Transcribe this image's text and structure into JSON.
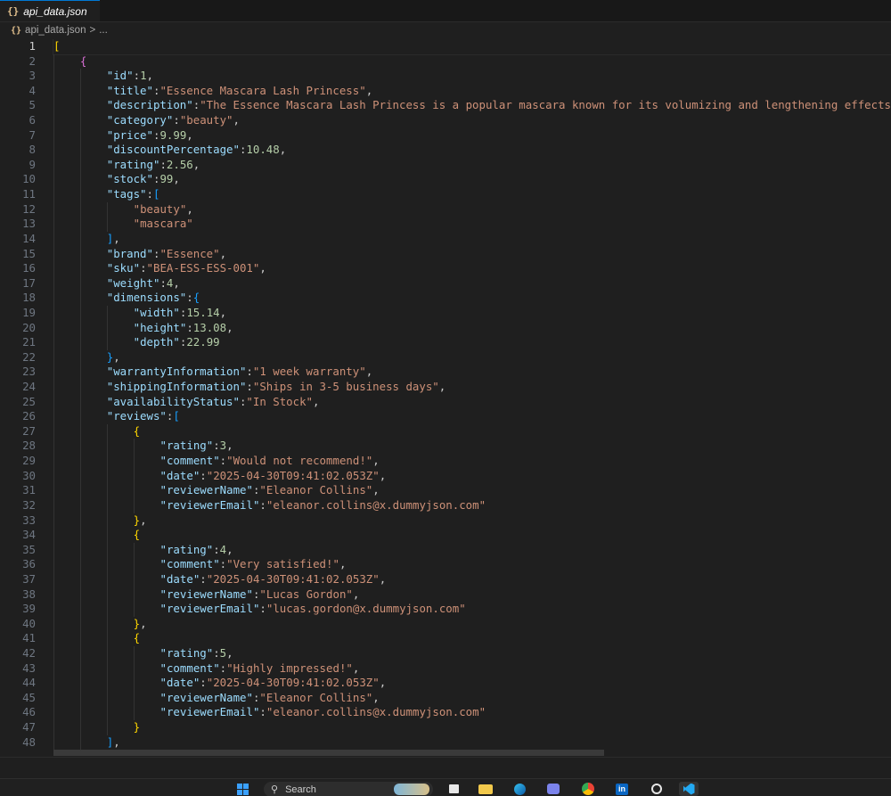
{
  "tab": {
    "file_name": "api_data.json",
    "icon": "json-braces-icon",
    "icon_glyph": "{}"
  },
  "breadcrumb": {
    "file_name": "api_data.json",
    "separator": ">",
    "more": "..."
  },
  "editor": {
    "active_line": 1,
    "lines": [
      [
        [
          "b1",
          "["
        ]
      ],
      [
        [
          "b2",
          "{"
        ]
      ],
      [
        [
          "key",
          "\"id\""
        ],
        [
          "p",
          ":"
        ],
        [
          "num",
          "1"
        ],
        [
          "p",
          ","
        ]
      ],
      [
        [
          "key",
          "\"title\""
        ],
        [
          "p",
          ":"
        ],
        [
          "str",
          "\"Essence Mascara Lash Princess\""
        ],
        [
          "p",
          ","
        ]
      ],
      [
        [
          "key",
          "\"description\""
        ],
        [
          "p",
          ":"
        ],
        [
          "str",
          "\"The Essence Mascara Lash Princess is a popular mascara known for its volumizing and lengthening effects. Achieve d"
        ]
      ],
      [
        [
          "key",
          "\"category\""
        ],
        [
          "p",
          ":"
        ],
        [
          "str",
          "\"beauty\""
        ],
        [
          "p",
          ","
        ]
      ],
      [
        [
          "key",
          "\"price\""
        ],
        [
          "p",
          ":"
        ],
        [
          "num",
          "9.99"
        ],
        [
          "p",
          ","
        ]
      ],
      [
        [
          "key",
          "\"discountPercentage\""
        ],
        [
          "p",
          ":"
        ],
        [
          "num",
          "10.48"
        ],
        [
          "p",
          ","
        ]
      ],
      [
        [
          "key",
          "\"rating\""
        ],
        [
          "p",
          ":"
        ],
        [
          "num",
          "2.56"
        ],
        [
          "p",
          ","
        ]
      ],
      [
        [
          "key",
          "\"stock\""
        ],
        [
          "p",
          ":"
        ],
        [
          "num",
          "99"
        ],
        [
          "p",
          ","
        ]
      ],
      [
        [
          "key",
          "\"tags\""
        ],
        [
          "p",
          ":"
        ],
        [
          "b3",
          "["
        ]
      ],
      [
        [
          "str",
          "\"beauty\""
        ],
        [
          "p",
          ","
        ]
      ],
      [
        [
          "str",
          "\"mascara\""
        ]
      ],
      [
        [
          "b3",
          "]"
        ],
        [
          "p",
          ","
        ]
      ],
      [
        [
          "key",
          "\"brand\""
        ],
        [
          "p",
          ":"
        ],
        [
          "str",
          "\"Essence\""
        ],
        [
          "p",
          ","
        ]
      ],
      [
        [
          "key",
          "\"sku\""
        ],
        [
          "p",
          ":"
        ],
        [
          "str",
          "\"BEA-ESS-ESS-001\""
        ],
        [
          "p",
          ","
        ]
      ],
      [
        [
          "key",
          "\"weight\""
        ],
        [
          "p",
          ":"
        ],
        [
          "num",
          "4"
        ],
        [
          "p",
          ","
        ]
      ],
      [
        [
          "key",
          "\"dimensions\""
        ],
        [
          "p",
          ":"
        ],
        [
          "b3",
          "{"
        ]
      ],
      [
        [
          "key",
          "\"width\""
        ],
        [
          "p",
          ":"
        ],
        [
          "num",
          "15.14"
        ],
        [
          "p",
          ","
        ]
      ],
      [
        [
          "key",
          "\"height\""
        ],
        [
          "p",
          ":"
        ],
        [
          "num",
          "13.08"
        ],
        [
          "p",
          ","
        ]
      ],
      [
        [
          "key",
          "\"depth\""
        ],
        [
          "p",
          ":"
        ],
        [
          "num",
          "22.99"
        ]
      ],
      [
        [
          "b3",
          "}"
        ],
        [
          "p",
          ","
        ]
      ],
      [
        [
          "key",
          "\"warrantyInformation\""
        ],
        [
          "p",
          ":"
        ],
        [
          "str",
          "\"1 week warranty\""
        ],
        [
          "p",
          ","
        ]
      ],
      [
        [
          "key",
          "\"shippingInformation\""
        ],
        [
          "p",
          ":"
        ],
        [
          "str",
          "\"Ships in 3-5 business days\""
        ],
        [
          "p",
          ","
        ]
      ],
      [
        [
          "key",
          "\"availabilityStatus\""
        ],
        [
          "p",
          ":"
        ],
        [
          "str",
          "\"In Stock\""
        ],
        [
          "p",
          ","
        ]
      ],
      [
        [
          "key",
          "\"reviews\""
        ],
        [
          "p",
          ":"
        ],
        [
          "b3",
          "["
        ]
      ],
      [
        [
          "b1",
          "{"
        ]
      ],
      [
        [
          "key",
          "\"rating\""
        ],
        [
          "p",
          ":"
        ],
        [
          "num",
          "3"
        ],
        [
          "p",
          ","
        ]
      ],
      [
        [
          "key",
          "\"comment\""
        ],
        [
          "p",
          ":"
        ],
        [
          "str",
          "\"Would not recommend!\""
        ],
        [
          "p",
          ","
        ]
      ],
      [
        [
          "key",
          "\"date\""
        ],
        [
          "p",
          ":"
        ],
        [
          "str",
          "\"2025-04-30T09:41:02.053Z\""
        ],
        [
          "p",
          ","
        ]
      ],
      [
        [
          "key",
          "\"reviewerName\""
        ],
        [
          "p",
          ":"
        ],
        [
          "str",
          "\"Eleanor Collins\""
        ],
        [
          "p",
          ","
        ]
      ],
      [
        [
          "key",
          "\"reviewerEmail\""
        ],
        [
          "p",
          ":"
        ],
        [
          "str",
          "\"eleanor.collins@x.dummyjson.com\""
        ]
      ],
      [
        [
          "b1",
          "}"
        ],
        [
          "p",
          ","
        ]
      ],
      [
        [
          "b1",
          "{"
        ]
      ],
      [
        [
          "key",
          "\"rating\""
        ],
        [
          "p",
          ":"
        ],
        [
          "num",
          "4"
        ],
        [
          "p",
          ","
        ]
      ],
      [
        [
          "key",
          "\"comment\""
        ],
        [
          "p",
          ":"
        ],
        [
          "str",
          "\"Very satisfied!\""
        ],
        [
          "p",
          ","
        ]
      ],
      [
        [
          "key",
          "\"date\""
        ],
        [
          "p",
          ":"
        ],
        [
          "str",
          "\"2025-04-30T09:41:02.053Z\""
        ],
        [
          "p",
          ","
        ]
      ],
      [
        [
          "key",
          "\"reviewerName\""
        ],
        [
          "p",
          ":"
        ],
        [
          "str",
          "\"Lucas Gordon\""
        ],
        [
          "p",
          ","
        ]
      ],
      [
        [
          "key",
          "\"reviewerEmail\""
        ],
        [
          "p",
          ":"
        ],
        [
          "str",
          "\"lucas.gordon@x.dummyjson.com\""
        ]
      ],
      [
        [
          "b1",
          "}"
        ],
        [
          "p",
          ","
        ]
      ],
      [
        [
          "b1",
          "{"
        ]
      ],
      [
        [
          "key",
          "\"rating\""
        ],
        [
          "p",
          ":"
        ],
        [
          "num",
          "5"
        ],
        [
          "p",
          ","
        ]
      ],
      [
        [
          "key",
          "\"comment\""
        ],
        [
          "p",
          ":"
        ],
        [
          "str",
          "\"Highly impressed!\""
        ],
        [
          "p",
          ","
        ]
      ],
      [
        [
          "key",
          "\"date\""
        ],
        [
          "p",
          ":"
        ],
        [
          "str",
          "\"2025-04-30T09:41:02.053Z\""
        ],
        [
          "p",
          ","
        ]
      ],
      [
        [
          "key",
          "\"reviewerName\""
        ],
        [
          "p",
          ":"
        ],
        [
          "str",
          "\"Eleanor Collins\""
        ],
        [
          "p",
          ","
        ]
      ],
      [
        [
          "key",
          "\"reviewerEmail\""
        ],
        [
          "p",
          ":"
        ],
        [
          "str",
          "\"eleanor.collins@x.dummyjson.com\""
        ]
      ],
      [
        [
          "b1",
          "}"
        ]
      ],
      [
        [
          "b3",
          "]"
        ],
        [
          "p",
          ","
        ]
      ]
    ]
  },
  "taskbar": {
    "search_placeholder": "Search",
    "apps": [
      "windows-start-icon",
      "search-icon",
      "task-view-icon",
      "file-explorer-icon",
      "edge-icon",
      "teams-icon",
      "chrome-icon",
      "linkedin-icon",
      "chatgpt-icon",
      "vscode-icon"
    ]
  },
  "colors": {
    "background": "#1f1f1f",
    "key": "#9cdcfe",
    "string": "#ce9178",
    "number": "#b5cea8",
    "bracket_gold": "#ffd700",
    "bracket_purple": "#da70d6",
    "bracket_blue": "#179fff"
  }
}
